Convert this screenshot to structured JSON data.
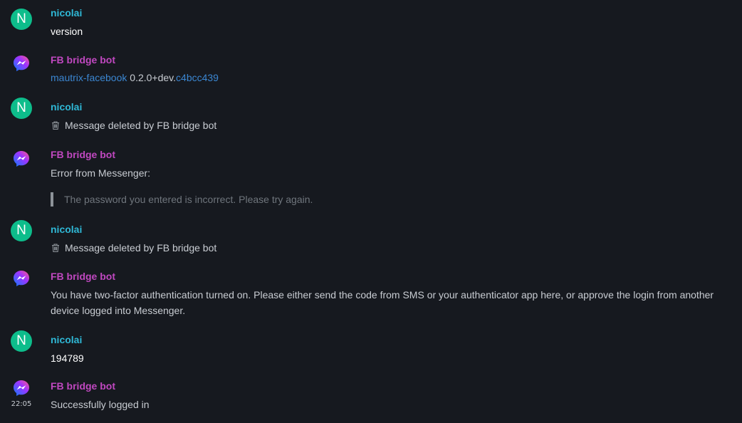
{
  "events": [
    {
      "sender": "nicolai",
      "avatar_letter": "N",
      "body": "version"
    },
    {
      "sender": "FB bridge bot",
      "link1": "mautrix-facebook",
      "middle": " 0.2.0+dev.",
      "link2": "c4bcc439"
    },
    {
      "sender": "nicolai",
      "avatar_letter": "N",
      "body": "Message deleted by FB bridge bot"
    },
    {
      "sender": "FB bridge bot",
      "body": "Error from Messenger:",
      "quote": "The password you entered is incorrect. Please try again."
    },
    {
      "sender": "nicolai",
      "avatar_letter": "N",
      "body": "Message deleted by FB bridge bot"
    },
    {
      "sender": "FB bridge bot",
      "body": "You have two-factor authentication turned on. Please either send the code from SMS or your authenticator app here, or approve the login from another device logged into Messenger."
    },
    {
      "sender": "nicolai",
      "avatar_letter": "N",
      "body": "194789"
    },
    {
      "sender": "FB bridge bot",
      "body": "Successfully logged in",
      "timestamp": "22:05"
    }
  ],
  "colors": {
    "background": "#16191f",
    "nicolai_name": "#2fb8d6",
    "bot_name": "#c048c0",
    "avatar_green": "#0dbd8b",
    "link": "#3b86d1"
  },
  "icons": {
    "bot_avatar": "messenger-icon",
    "deleted": "trash-icon"
  }
}
